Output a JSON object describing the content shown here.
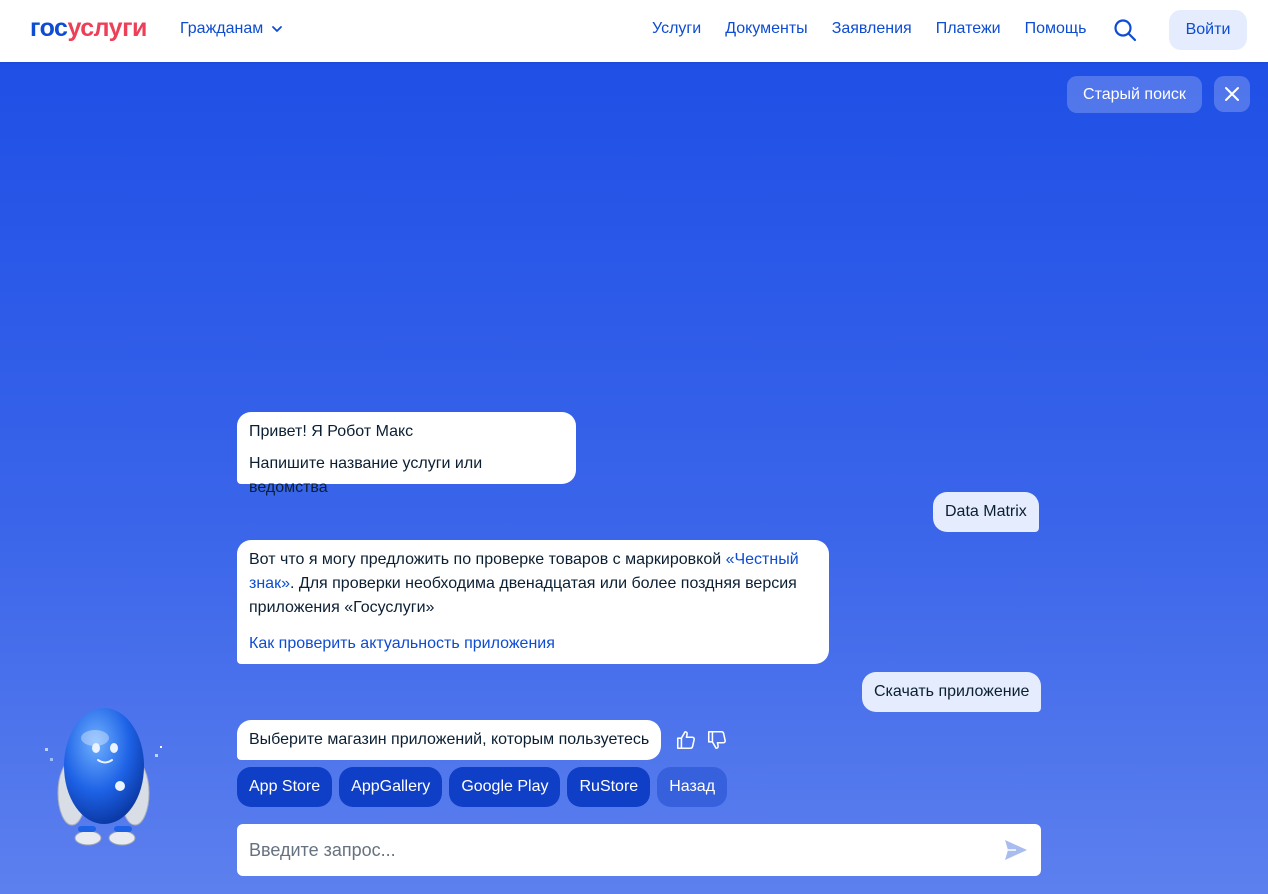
{
  "header": {
    "logo_part1": "гос",
    "logo_part2": "услуги",
    "audience_label": "Гражданам",
    "nav": [
      "Услуги",
      "Документы",
      "Заявления",
      "Платежи",
      "Помощь"
    ],
    "login_label": "Войти"
  },
  "top_actions": {
    "old_search_label": "Старый поиск"
  },
  "chat": {
    "bot_greeting_line1": "Привет! Я Робот Макс",
    "bot_greeting_line2": "Напишите название услуги или ведомства",
    "user_message_1": "Data Matrix",
    "bot_reply_text_1": "Вот что я могу предложить по проверке товаров с маркировкой ",
    "bot_reply_link_1": "«Честный знак»",
    "bot_reply_text_2": ". Для проверки необходима двенадцатая или более поздняя версия приложения «Госуслуги»",
    "bot_reply_sublink": "Как проверить актуальность приложения",
    "user_message_2": "Скачать приложение",
    "bot_question": "Выберите магазин приложений, которым пользуетесь",
    "options": [
      "App Store",
      "AppGallery",
      "Google Play",
      "RuStore",
      "Назад"
    ]
  },
  "input": {
    "placeholder": "Введите запрос..."
  },
  "icons": {
    "search": "search-icon",
    "close": "close-icon",
    "like": "thumbs-up-icon",
    "dislike": "thumbs-down-icon",
    "send": "send-icon",
    "chevron": "chevron-down-icon"
  },
  "colors": {
    "brand_blue": "#0d4cd3",
    "brand_red": "#ee3f58",
    "chip_bg": "#0f3fc6",
    "user_bubble": "#e4ecfd"
  }
}
